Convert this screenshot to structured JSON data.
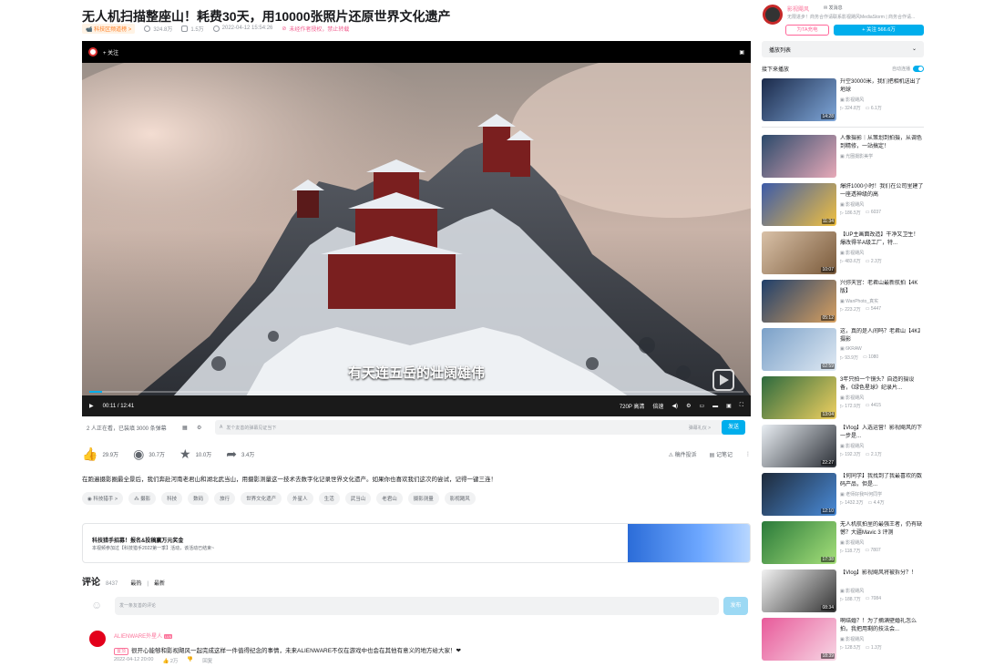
{
  "video": {
    "title": "无人机扫描整座山！耗费30天，用10000张照片还原世界文化遗产",
    "badge": "📹 科技区频道榜 >",
    "views": "324.8万",
    "danmaku": "1.5万",
    "date": "2022-04-12 15:54:26",
    "copyright": "未经作者授权，禁止转载"
  },
  "player": {
    "follow_label": "+ 关注",
    "subtitle": "有天连五岳的壮阔雄伟",
    "progress": 0.02,
    "time": "00:11 / 12:41",
    "quality": "720P 高清",
    "speed": "倍速"
  },
  "danmaku_bar": {
    "info": "2 人正在看，已装填 3000 条弹幕",
    "placeholder": "发个友善的弹幕见证当下",
    "etiquette": "弹幕礼仪 >",
    "send": "发送"
  },
  "actions": {
    "like": "29.9万",
    "coin": "30.7万",
    "fav": "10.0万",
    "share": "3.4万",
    "report": "稿件投诉",
    "notes": "记笔记"
  },
  "description": "在跑遍摄影圈最全景后，我们奔赴河南老君山和湖北武当山，用摄影测量这一技术去数字化记录世界文化遗产。如果你也喜欢我们这次的尝试，记得一键三连！",
  "tags": [
    "◉ 科技猎手 >",
    "⁂ 摄影",
    "科技",
    "数码",
    "旅行",
    "世界文化遗产",
    "外星人",
    "生活",
    "武当山",
    "老君山",
    "摄影测量",
    "影视飓风"
  ],
  "ad": {
    "title": "科技猎手招募！报名&投稿赢万元奖金",
    "subtitle": "本视频参加过【科技猎手2022第一季】活动，该活动已结束~"
  },
  "comments": {
    "title": "评论",
    "count": "8437",
    "sort_hot": "最热",
    "sort_new": "最新",
    "placeholder": "发一条友善的评论",
    "post": "发布",
    "first": {
      "user": "ALIENWARE外星人",
      "level": "LV6",
      "top": "置顶",
      "text": "很开心能够和影视飓风一起完成这样一件值得纪念的事情，未来ALIENWARE不仅在游戏中也会在其他有意义的地方给大家！❤",
      "date": "2022-04-12 20:00",
      "likes": "2万",
      "reply": "回复"
    }
  },
  "uploader": {
    "name": "影视飓风",
    "message": "✉ 发消息",
    "sign": "无限进步！商务合作请联系影视飓风MediaStorm | 商务合作请...",
    "charge": "为TA充电",
    "follow": "+ 关注 566.6万"
  },
  "playlist_label": "播放列表",
  "next_label": "接下来播放",
  "autoplay_label": "自动连播",
  "recommendations": [
    {
      "title": "升空30000米，我们把相机送出了地球",
      "author": "影视飓风",
      "views": "324.8万",
      "danmaku": "6.1万",
      "duration": "14:28"
    },
    {
      "title": "人像摄影｜从策划到拍摄，从调色到精修，一站搞定！",
      "author": "光圈摄影美学",
      "views": "",
      "danmaku": "",
      "duration": ""
    },
    {
      "title": "爆肝1000小时！我们在公司里建了一座透神级的高",
      "author": "影视飓风",
      "views": "186.5万",
      "danmaku": "6037",
      "duration": "11:34"
    },
    {
      "title": "【UP主画面改造】干净又卫生！爆改得半A级工厂，特...",
      "author": "影视飓风",
      "views": "483.6万",
      "danmaku": "2.3万",
      "duration": "10:07"
    },
    {
      "title": "兴弥天宫：老君山最新航拍【4K版】",
      "author": "WanPhoto_真实",
      "views": "223.2万",
      "danmaku": "5447",
      "duration": "05:12"
    },
    {
      "title": "这，真的是人间吗？老君山【4K】摄影",
      "author": "6KRAW",
      "views": "93.9万",
      "danmaku": "1080",
      "duration": "02:59"
    },
    {
      "title": "3年只拍一个镜头？自造的摄设备，《绿色星球》纪录片...",
      "author": "影视飓风",
      "views": "172.9万",
      "danmaku": "4415",
      "duration": "13:04"
    },
    {
      "title": "【Vlog】入选运营！影视飓风的下一步是...",
      "author": "影视飓风",
      "views": "192.3万",
      "danmaku": "2.1万",
      "duration": "22:27"
    },
    {
      "title": "【何同学】我找到了我最喜欢的数码产品，但是...",
      "author": "老师好我叫何同学",
      "views": "1432.3万",
      "danmaku": "4.4万",
      "duration": "12:10"
    },
    {
      "title": "无人机航拍里的最强王者，仍有缺憾？大疆Mavic 3 评测",
      "author": "影视飓风",
      "views": "118.7万",
      "danmaku": "7807",
      "duration": "17:38"
    },
    {
      "title": "【Vlog】影视飓风将被拆分？！",
      "author": "影视飓风",
      "views": "188.7万",
      "danmaku": "7084",
      "duration": "08:34"
    },
    {
      "title": "啊结婚？！为了摘满壁婚礼怎么拍，我把用剩的技法会...",
      "author": "影视飓风",
      "views": "128.5万",
      "danmaku": "1.3万",
      "duration": "18:39"
    }
  ]
}
